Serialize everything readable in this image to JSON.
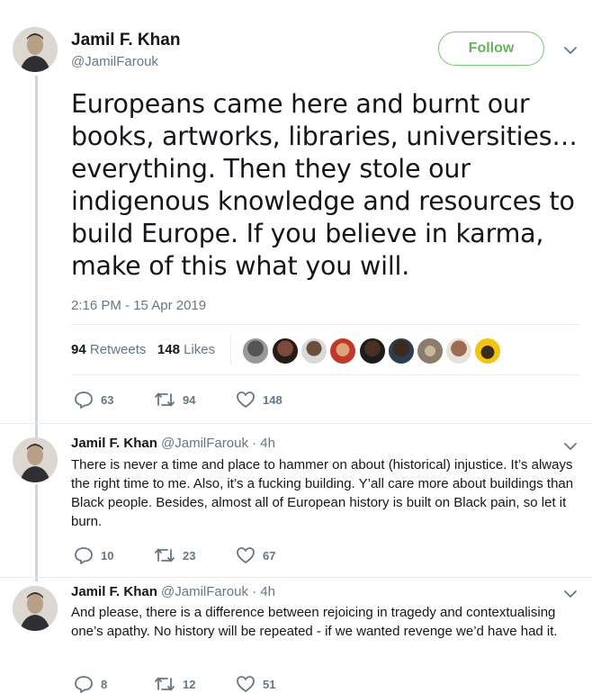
{
  "main_tweet": {
    "author_name": "Jamil F. Khan",
    "author_handle": "@JamilFarouk",
    "follow_label": "Follow",
    "text": "Europeans came here and burnt our books, artworks, libraries, universities… everything. Then they stole our indigenous knowledge and resources to build Europe. If you believe in karma, make of this what you will.",
    "timestamp": "2:16 PM - 15 Apr 2019",
    "retweets_count": "94",
    "retweets_label": "Retweets",
    "likes_count": "148",
    "likes_label": "Likes",
    "actions": {
      "replies": "63",
      "retweets": "94",
      "likes": "148"
    }
  },
  "replies": [
    {
      "author_name": "Jamil F. Khan",
      "author_handle": "@JamilFarouk · 4h",
      "text": "There is never a time and place to hammer on about (historical) injustice. It’s always the right time to me. Also, it’s a fucking building. Y’all care more about buildings than Black people. Besides, almost all of European history is built on Black pain, so let it burn.",
      "actions": {
        "replies": "10",
        "retweets": "23",
        "likes": "67"
      }
    },
    {
      "author_name": "Jamil F. Khan",
      "author_handle": "@JamilFarouk · 4h",
      "text": "And please, there is a difference between rejoicing in tragedy and contextualising one’s apathy. No history will be repeated - if we wanted revenge we’d have had it.",
      "actions": {
        "replies": "8",
        "retweets": "12",
        "likes": "51"
      }
    }
  ],
  "colors": {
    "follow_green": "#62b55a",
    "muted": "#657786",
    "thread_line": "#ccd6dd"
  }
}
